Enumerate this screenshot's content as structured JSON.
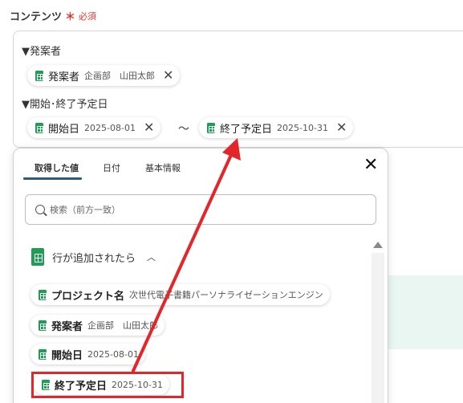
{
  "field": {
    "label": "コンテンツ",
    "required_mark": "＊",
    "required_text": "必須"
  },
  "content": {
    "header_proposer": "▼発案者",
    "chip_proposer": {
      "label": "発案者",
      "value": "企画部　山田太郎"
    },
    "header_dates": "▼開始･終了予定日",
    "chip_start": {
      "label": "開始日",
      "value": "2025-08-01"
    },
    "separator": "〜",
    "chip_end": {
      "label": "終了予定日",
      "value": "2025-10-31"
    },
    "remove_glyph": "✕"
  },
  "panel": {
    "tabs": [
      "取得した値",
      "日付",
      "基本情報"
    ],
    "active_tab": 0,
    "close_glyph": "✕",
    "search_placeholder": "検索（前方一致）",
    "group_label": "行が追加されたら",
    "group_caret": "︿",
    "items": [
      {
        "label": "プロジェクト名",
        "value": "次世代電子書籍パーソナライゼーションエンジン"
      },
      {
        "label": "発案者",
        "value": "企画部　山田太郎"
      },
      {
        "label": "開始日",
        "value": "2025-08-01"
      },
      {
        "label": "終了予定日",
        "value": "2025-10-31"
      }
    ]
  },
  "colors": {
    "accent_red": "#e3262a",
    "sheet_green": "#1f9d55",
    "tab_underline": "#2a5d80"
  }
}
